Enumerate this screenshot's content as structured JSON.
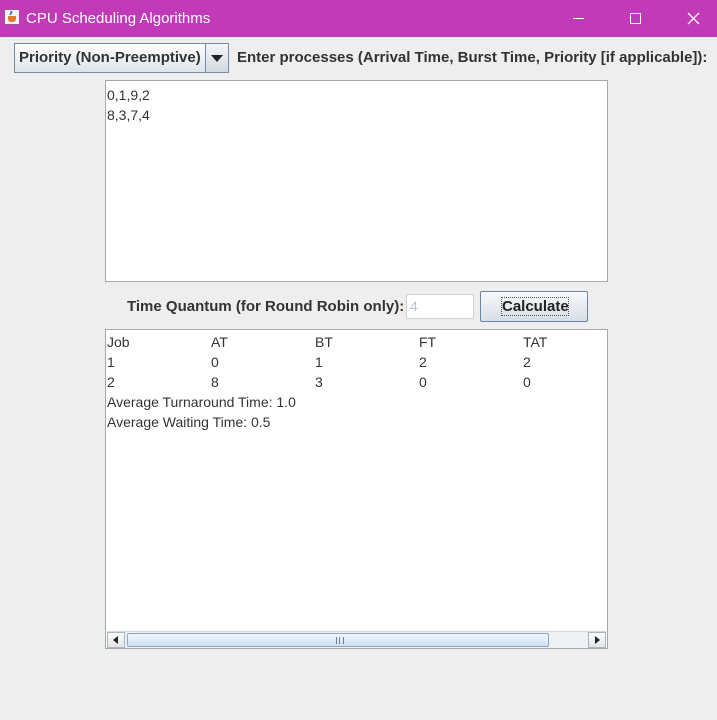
{
  "window": {
    "title": "CPU Scheduling Algorithms",
    "titlebar_color": "#c13bb8"
  },
  "algorithm_select": {
    "selected": "Priority (Non-Preemptive)"
  },
  "instructions": "Enter processes (Arrival Time, Burst Time, Priority [if applicable]):",
  "input": {
    "lines": [
      "0,1,9,2",
      "8,3,7,4"
    ]
  },
  "quantum": {
    "label": "Time Quantum (for Round Robin only):",
    "value": "4"
  },
  "calculate_label": "Calculate",
  "results": {
    "headers": [
      "Job",
      "AT",
      "BT",
      "FT",
      "TAT"
    ],
    "rows": [
      [
        "1",
        "0",
        "1",
        "2",
        "2"
      ],
      [
        "2",
        "8",
        "3",
        "0",
        "0"
      ]
    ],
    "avg_turnaround": "Average Turnaround Time: 1.0",
    "avg_waiting": "Average Waiting Time: 0.5"
  }
}
